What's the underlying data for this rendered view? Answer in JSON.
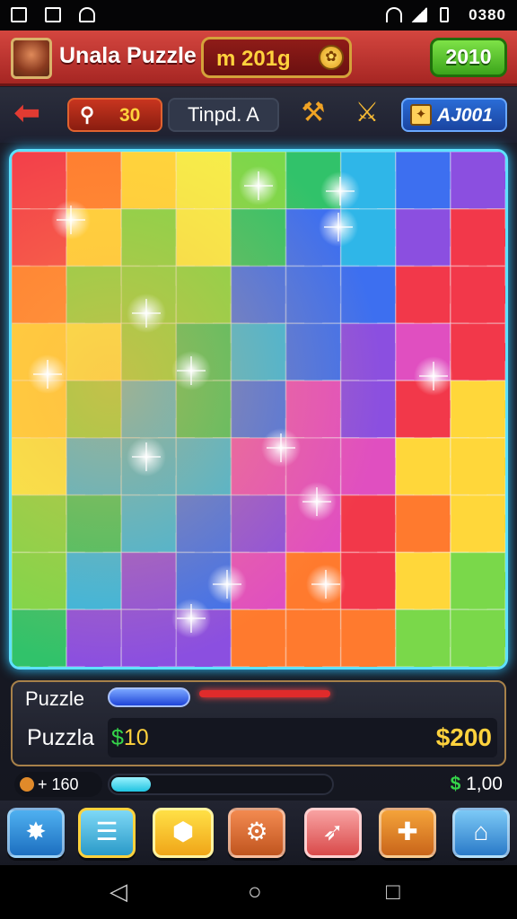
{
  "status_bar": {
    "time": "0380"
  },
  "header": {
    "title": "Unala Puzzle",
    "coins": "m 201g",
    "level_button": "2010"
  },
  "toolbar": {
    "search_value": "30",
    "tool_name": "Tinpd. A",
    "score": "AJ001"
  },
  "progress": {
    "label_1": "Puzzle",
    "label_2": "Puzzla",
    "money_small": "$10",
    "money_large": "$200",
    "bar_1_fraction": 0.62,
    "bar_1_secondary_fraction": 0.62
  },
  "stats": {
    "left_text": "+ 160",
    "right_text": "$ 1,00",
    "bar_fraction": 0.18
  },
  "colors": {
    "accent_red": "#c63a33",
    "accent_green": "#5cc531",
    "glow": "#5fe2ff",
    "coin": "#ffd23d"
  },
  "icons": {
    "back": "back-arrow-icon",
    "search": "search-icon",
    "tool_a": "hammer-icon",
    "tool_b": "crossed-swords-icon",
    "score": "puzzle-map-icon",
    "menu": [
      "star-icon",
      "list-icon",
      "gem-icon",
      "gear-icon",
      "rocket-icon",
      "puzzle-piece-icon",
      "home-icon"
    ]
  },
  "puzzle": {
    "columns": 9,
    "rows": 9
  }
}
